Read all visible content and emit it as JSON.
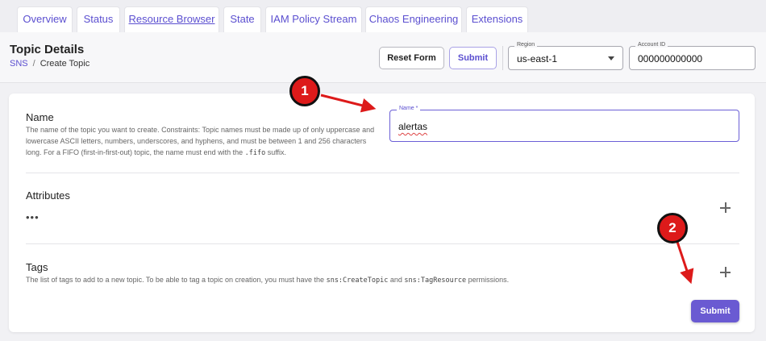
{
  "tabs": [
    {
      "label": "Overview",
      "active": false
    },
    {
      "label": "Status",
      "active": false
    },
    {
      "label": "Resource Browser",
      "active": true
    },
    {
      "label": "State",
      "active": false
    },
    {
      "label": "IAM Policy Stream",
      "active": false
    },
    {
      "label": "Chaos Engineering",
      "active": false
    },
    {
      "label": "Extensions",
      "active": false
    }
  ],
  "header": {
    "title": "Topic Details",
    "breadcrumb": {
      "parent": "SNS",
      "separator": "/",
      "current": "Create Topic"
    },
    "reset_label": "Reset Form",
    "submit_label": "Submit",
    "region": {
      "label": "Region",
      "value": "us-east-1"
    },
    "account": {
      "label": "Account ID",
      "value": "000000000000"
    }
  },
  "form": {
    "name": {
      "title": "Name",
      "description_pre": "The name of the topic you want to create. Constraints: Topic names must be made up of only uppercase and lowercase ASCII letters, numbers, underscores, and hyphens, and must be between 1 and 256 characters long. For a FIFO (first-in-first-out) topic, the name must end with the ",
      "description_code": ".fifo",
      "description_post": " suffix.",
      "field_label": "Name *",
      "value": "alertas"
    },
    "attributes": {
      "title": "Attributes",
      "more": "•••"
    },
    "tags": {
      "title": "Tags",
      "description_pre": "The list of tags to add to a new topic. To be able to tag a topic on creation, you must have the ",
      "code1": "sns:CreateTopic",
      "mid": " and ",
      "code2": "sns:TagResource",
      "description_post": " permissions."
    },
    "submit_label": "Submit"
  },
  "annotations": [
    {
      "label": "1",
      "color": "#dd1a1a"
    },
    {
      "label": "2",
      "color": "#dd1a1a"
    }
  ],
  "colors": {
    "accent": "#6a5ad2",
    "link": "#5b4fd0",
    "annotation": "#dd1a1a"
  }
}
